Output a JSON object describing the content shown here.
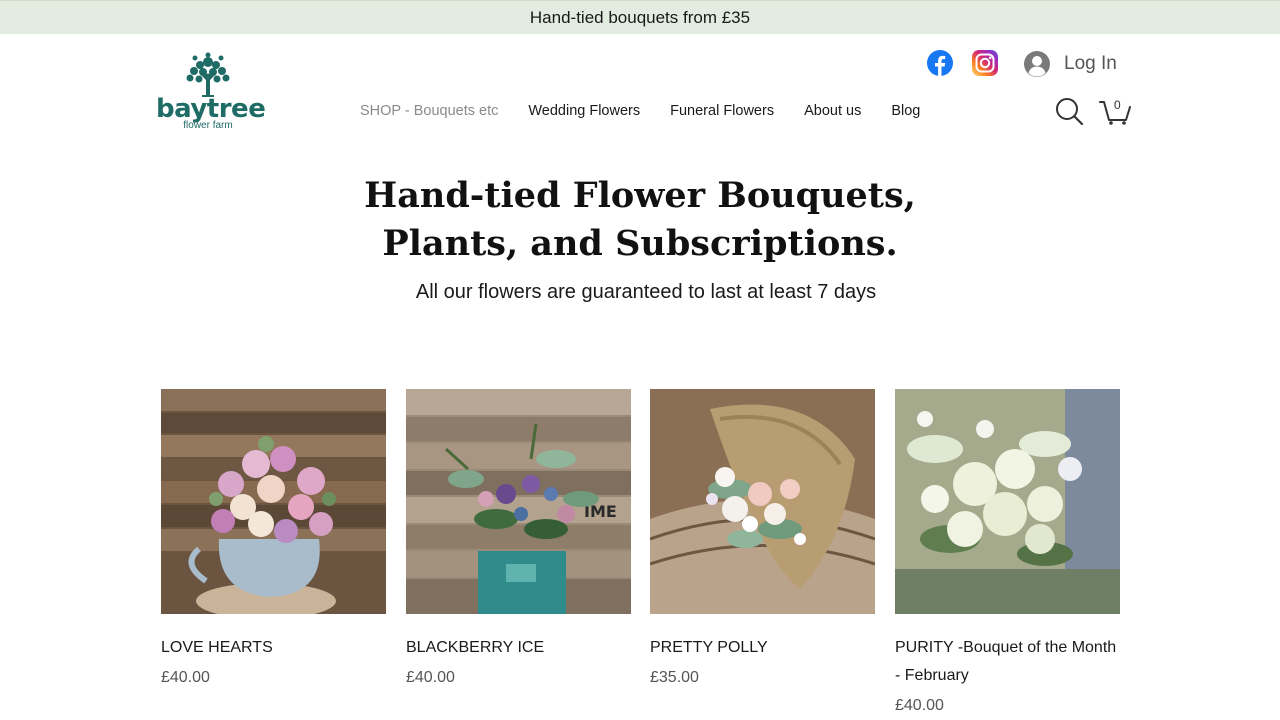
{
  "announcement": "Hand-tied bouquets from £35",
  "logo": {
    "name": "baytree",
    "tagline": "flower farm"
  },
  "header": {
    "login_label": "Log In",
    "cart_count": "0",
    "social": [
      {
        "icon": "facebook-icon"
      },
      {
        "icon": "instagram-icon"
      }
    ]
  },
  "nav": {
    "items": [
      {
        "label": "SHOP - Bouquets etc",
        "active": true
      },
      {
        "label": "Wedding Flowers"
      },
      {
        "label": "Funeral Flowers"
      },
      {
        "label": "About us"
      },
      {
        "label": "Blog"
      }
    ]
  },
  "hero": {
    "title_line1": "Hand-tied Flower Bouquets,",
    "title_line2": "Plants, and Subscriptions.",
    "subtitle": "All our flowers are guaranteed to last at least 7 days"
  },
  "products": [
    {
      "name": "LOVE HEARTS",
      "price": "£40.00"
    },
    {
      "name": "BLACKBERRY ICE",
      "price": "£40.00"
    },
    {
      "name": "PRETTY POLLY",
      "price": "£35.00"
    },
    {
      "name": "PURITY -Bouquet of the Month - February",
      "price": "£40.00"
    }
  ],
  "colors": {
    "announcement_bg": "#e3ece1",
    "brand": "#1f6b66",
    "facebook": "#1877f2"
  }
}
